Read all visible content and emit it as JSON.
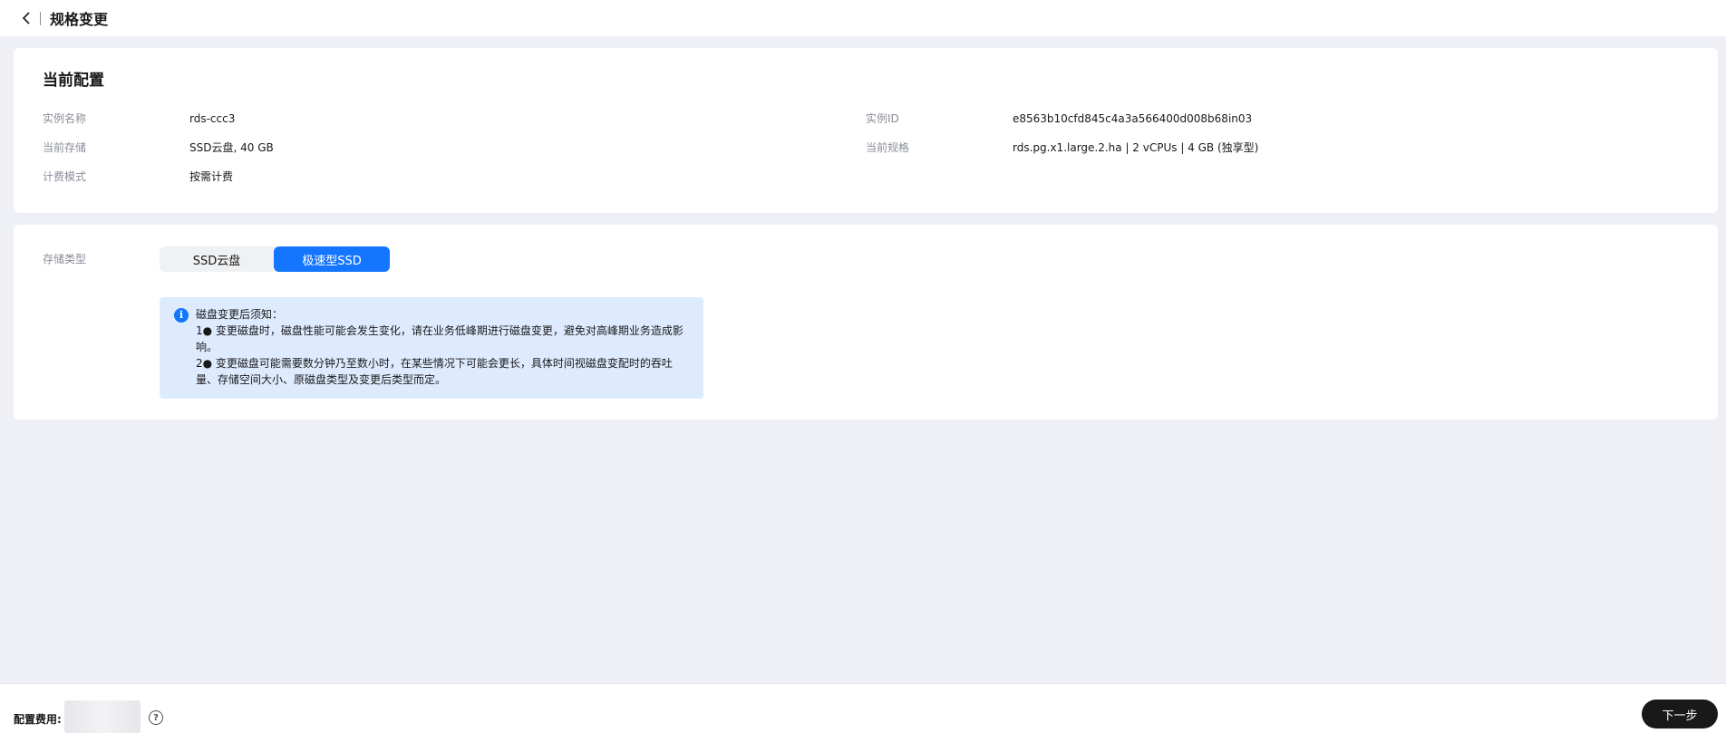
{
  "header": {
    "title": "规格变更",
    "back_icon": "chevron-left-icon"
  },
  "current_config": {
    "heading": "当前配置",
    "instance_name_label": "实例名称",
    "instance_name_value": "rds-ccc3",
    "instance_id_label": "实例ID",
    "instance_id_value": "e8563b10cfd845c4a3a566400d008b68in03",
    "storage_label": "当前存储",
    "storage_value": "SSD云盘, 40 GB",
    "spec_label": "当前规格",
    "spec_value": "rds.pg.x1.large.2.ha | 2 vCPUs | 4 GB (独享型)",
    "billing_label": "计费模式",
    "billing_value": "按需计费"
  },
  "storage": {
    "type_label": "存储类型",
    "options": [
      "SSD云盘",
      "极速型SSD"
    ],
    "selected": "极速型SSD",
    "notice": {
      "icon": "info-icon",
      "title": "磁盘变更后须知：",
      "line1": "1● 变更磁盘时，磁盘性能可能会发生变化，请在业务低峰期进行磁盘变更，避免对高峰期业务造成影",
      "line1b": "响。",
      "line2": "2● 变更磁盘可能需要数分钟乃至数小时，在某些情况下可能会更长，具体时间视磁盘变配时的吞吐",
      "line2b": "量、存储空间大小、原磁盘类型及变更后类型而定。"
    }
  },
  "footer": {
    "fee_label": "配置费用:",
    "help_icon": "question-circle-icon",
    "next_label": "下一步"
  },
  "colors": {
    "accent": "#1476ff",
    "notice_bg": "#deebff",
    "primary_button": "#191919"
  }
}
